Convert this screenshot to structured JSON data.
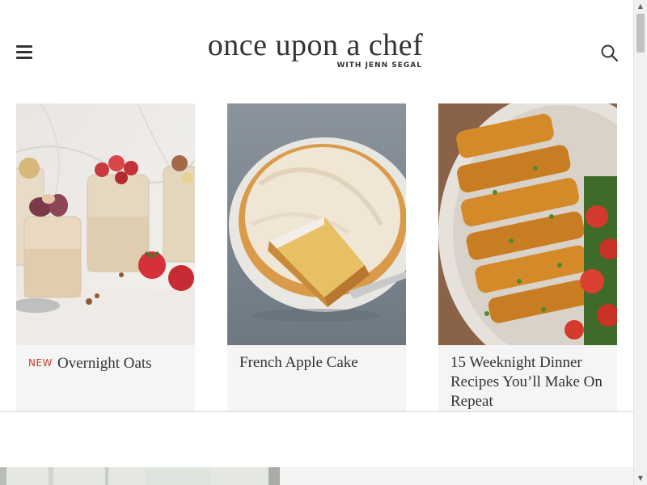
{
  "header": {
    "logo_title": "once upon a chef",
    "logo_subtitle": "WITH JENN SEGAL",
    "menu_icon": "hamburger-menu-icon",
    "search_icon": "search-icon"
  },
  "cards": [
    {
      "tag": "NEW",
      "title": "Overnight Oats",
      "image": "overnight-oats-jars-photo"
    },
    {
      "tag": "",
      "title": "French Apple Cake",
      "image": "french-apple-cake-photo"
    },
    {
      "tag": "",
      "title": "15 Weeknight Dinner Recipes You’ll Make On Repeat",
      "image": "chicken-cutlet-salad-photo"
    }
  ],
  "colors": {
    "text": "#333333",
    "new_tag": "#c43c2a",
    "card_bg": "#f5f5f5"
  },
  "scrollbar": {
    "up_icon": "scroll-up-arrow-icon",
    "down_icon": "scroll-down-arrow-icon"
  }
}
